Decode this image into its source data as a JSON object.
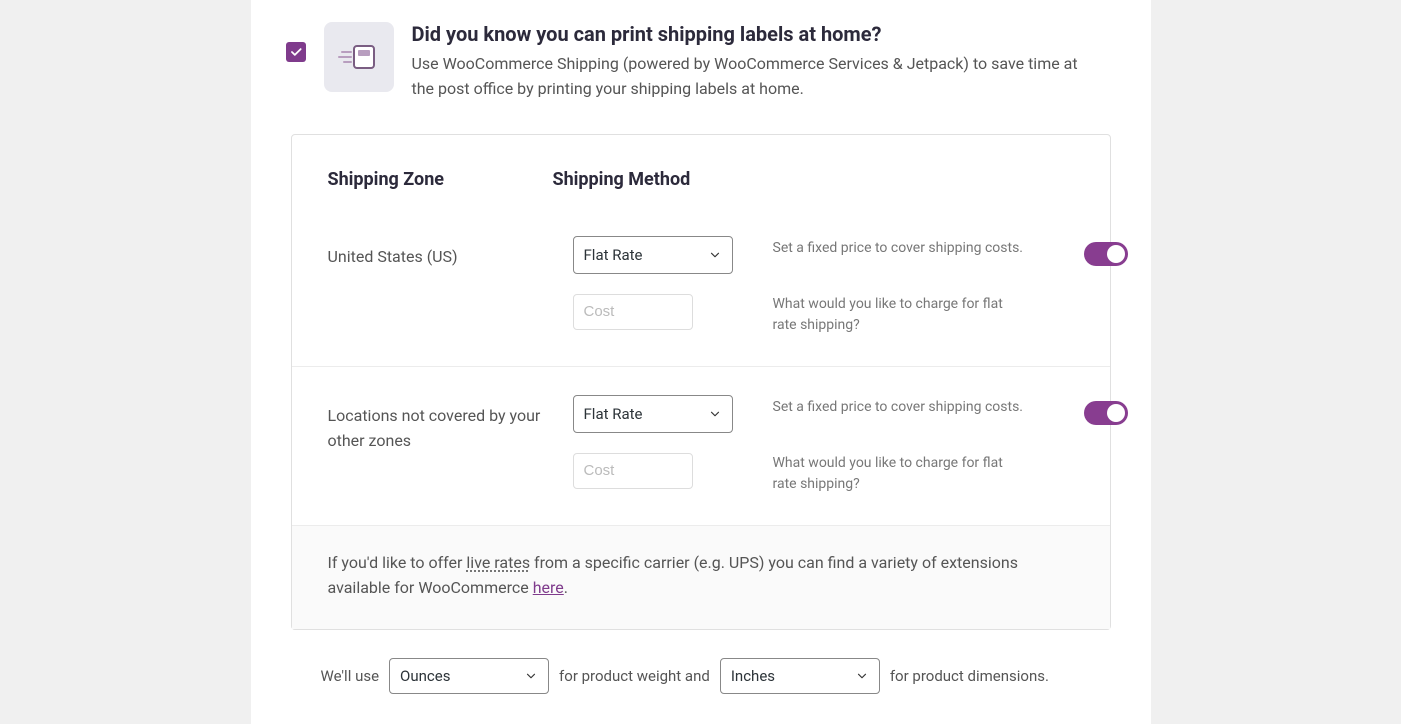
{
  "banner": {
    "title": "Did you know you can print shipping labels at home?",
    "desc": "Use WooCommerce Shipping (powered by WooCommerce Services & Jetpack) to save time at the post office by printing your shipping labels at home."
  },
  "headers": {
    "zone": "Shipping Zone",
    "method": "Shipping Method"
  },
  "zones": [
    {
      "name": "United States (US)",
      "method": "Flat Rate",
      "method_desc": "Set a fixed price to cover shipping costs.",
      "cost_placeholder": "Cost",
      "cost_desc": "What would you like to charge for flat rate shipping?"
    },
    {
      "name": "Locations not covered by your other zones",
      "method": "Flat Rate",
      "method_desc": "Set a fixed price to cover shipping costs.",
      "cost_placeholder": "Cost",
      "cost_desc": "What would you like to charge for flat rate shipping?"
    }
  ],
  "footer": {
    "pre": "If you'd like to offer ",
    "live_rates": "live rates",
    "mid": " from a specific carrier (e.g. UPS) you can find a variety of extensions available for WooCommerce ",
    "link": "here",
    "post": "."
  },
  "units": {
    "pre": "We'll use",
    "weight": "Ounces",
    "mid": "for product weight and",
    "dim": "Inches",
    "post": "for product dimensions."
  }
}
